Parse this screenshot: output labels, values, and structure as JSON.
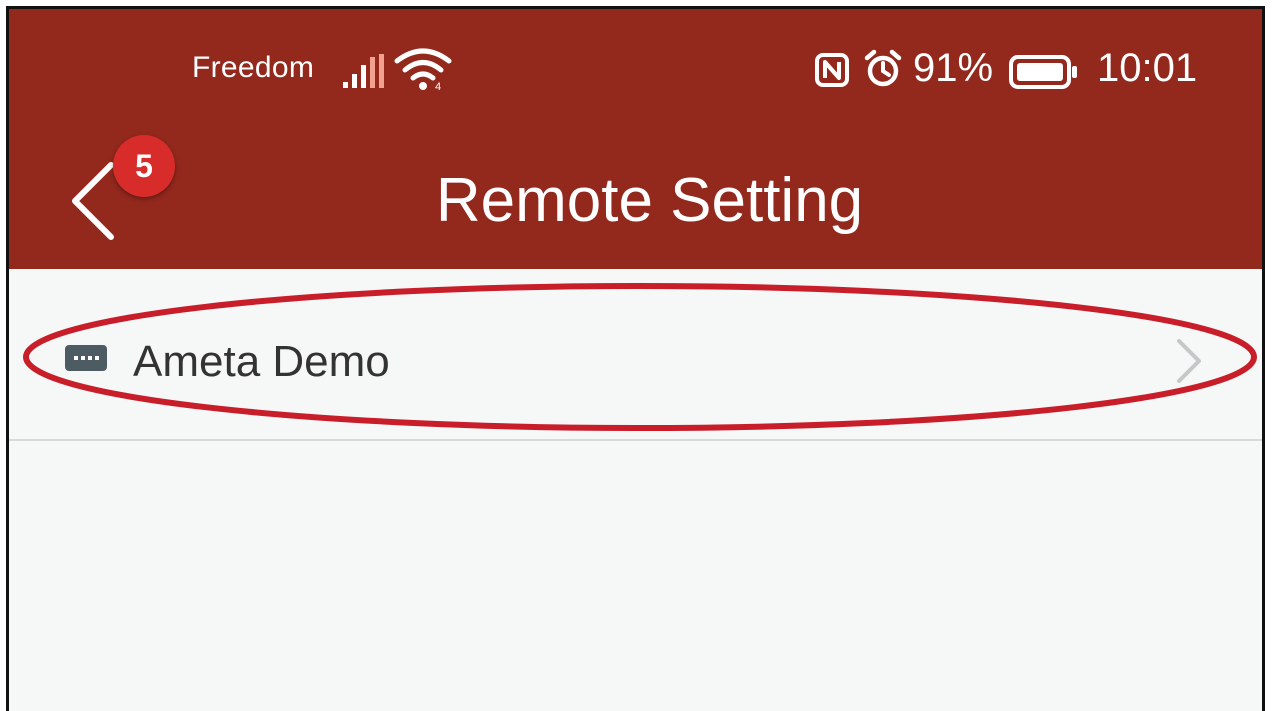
{
  "status_bar": {
    "carrier": "Freedom",
    "battery_percent": "91%",
    "time": "10:01",
    "icons": [
      "signal-bars-icon",
      "wifi-icon",
      "nfc-icon",
      "alarm-icon",
      "battery-icon"
    ]
  },
  "toolbar": {
    "back_icon": "chevron-left-icon",
    "badge_count": "5",
    "title": "Remote Setting"
  },
  "list": {
    "items": [
      {
        "label": "Ameta Demo",
        "icon": "device-icon",
        "chevron": "chevron-right-icon"
      }
    ]
  },
  "colors": {
    "appbar": "#93281d",
    "badge": "#d82c2b",
    "background": "#f6f7f7",
    "highlight_ellipse": "#c81e2a"
  }
}
